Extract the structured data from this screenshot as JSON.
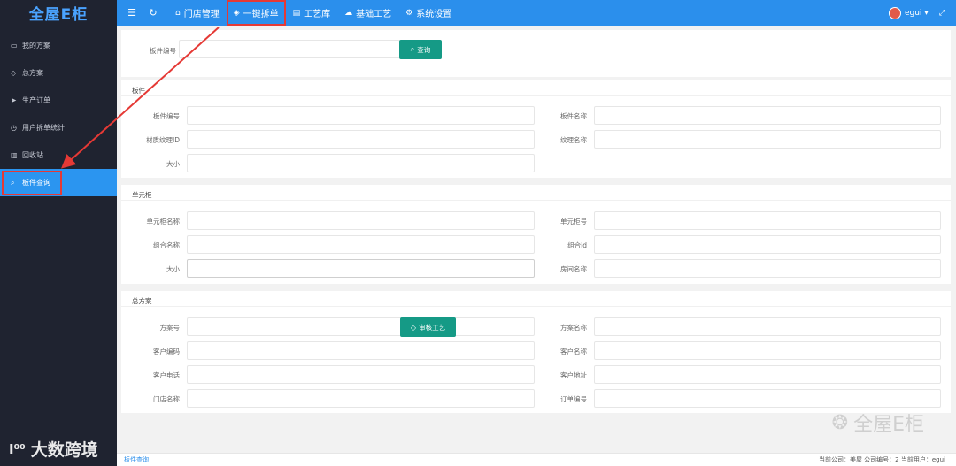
{
  "sidebar": {
    "logo": "全屋E柜",
    "items": [
      {
        "icon": "folder-icon",
        "glyph": "▭",
        "label": "我的方案"
      },
      {
        "icon": "diamond-icon",
        "glyph": "◇",
        "label": "总方案"
      },
      {
        "icon": "send-icon",
        "glyph": "➤",
        "label": "生产订单"
      },
      {
        "icon": "clock-icon",
        "glyph": "◷",
        "label": "用户拆单统计"
      },
      {
        "icon": "trash-icon",
        "glyph": "▥",
        "label": "回收站"
      },
      {
        "icon": "search-icon",
        "glyph": "⌕",
        "label": "板件查询",
        "active": true
      }
    ]
  },
  "topbar": {
    "menu_icon": "☰",
    "refresh_icon": "↻",
    "nav": [
      {
        "icon": "home-icon",
        "glyph": "⌂",
        "label": "门店管理"
      },
      {
        "icon": "shield-check-icon",
        "glyph": "◈",
        "label": "一键拆单",
        "highlight": true
      },
      {
        "icon": "book-icon",
        "glyph": "▤",
        "label": "工艺库"
      },
      {
        "icon": "cloud-icon",
        "glyph": "☁",
        "label": "基础工艺"
      },
      {
        "icon": "gear-icon",
        "glyph": "⚙",
        "label": "系统设置"
      }
    ],
    "user": "egui ▾",
    "expand_icon": "⤢"
  },
  "search": {
    "label": "板件编号",
    "value": "",
    "button": "查询"
  },
  "panel_board": {
    "title": "板件",
    "fields": {
      "board_no": {
        "label": "板件编号",
        "value": ""
      },
      "board_name": {
        "label": "板件名称",
        "value": ""
      },
      "texture_id": {
        "label": "材质纹理ID",
        "value": ""
      },
      "texture_name": {
        "label": "纹理名称",
        "value": ""
      },
      "size": {
        "label": "大小",
        "value": ""
      }
    }
  },
  "panel_unit": {
    "title": "单元柜",
    "fields": {
      "unit_name": {
        "label": "单元柜名称",
        "value": ""
      },
      "unit_no": {
        "label": "单元柜号",
        "value": ""
      },
      "group_name": {
        "label": "组合名称",
        "value": ""
      },
      "group_id": {
        "label": "组合id",
        "value": ""
      },
      "size": {
        "label": "大小",
        "value": ""
      },
      "room_name": {
        "label": "房间名称",
        "value": ""
      }
    }
  },
  "panel_plan": {
    "title": "总方案",
    "audit_button": "审核工艺",
    "fields": {
      "plan_no": {
        "label": "方案号",
        "value": ""
      },
      "plan_name": {
        "label": "方案名称",
        "value": ""
      },
      "customer_code": {
        "label": "客户编码",
        "value": ""
      },
      "customer_name": {
        "label": "客户名称",
        "value": ""
      },
      "customer_phone": {
        "label": "客户电话",
        "value": ""
      },
      "customer_addr": {
        "label": "客户地址",
        "value": ""
      },
      "store_name": {
        "label": "门店名称",
        "value": ""
      },
      "order_no": {
        "label": "订单编号",
        "value": ""
      }
    }
  },
  "footer": {
    "breadcrumb": "板件查询",
    "info": "当前公司：美屋   公司编号：2   当前用户：egui"
  },
  "watermarks": {
    "left": "大数跨境",
    "left_mark": "I⁰⁰",
    "right": "全屋E柜"
  },
  "colors": {
    "topbar": "#2b8fec",
    "sidebar": "#1f2330",
    "active": "#2b95f0",
    "button": "#159a86",
    "annotation": "#e53935"
  }
}
